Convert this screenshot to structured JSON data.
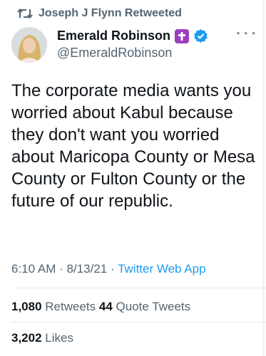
{
  "retweet_header": {
    "label": "Joseph J Flynn Retweeted",
    "icon": "retweet-icon"
  },
  "author": {
    "name": "Emerald Robinson",
    "handle": "@EmeraldRobinson",
    "badges": [
      "cross-icon",
      "verified-icon"
    ],
    "badge_colors": {
      "cross": "#9b3fbd",
      "verified": "#1d9bf0"
    }
  },
  "tweet": {
    "text": "The corporate media wants you worried about Kabul because they don't want you worried about Maricopa County or Mesa County or Fulton County or the future of our republic.",
    "time": "6:10 AM",
    "date": "8/13/21",
    "separator": "·",
    "source": "Twitter Web App"
  },
  "stats": {
    "retweets_count": "1,080",
    "retweets_label": "Retweets",
    "quote_count": "44",
    "quote_label": "Quote Tweets",
    "likes_count": "3,202",
    "likes_label": "Likes"
  },
  "colors": {
    "link": "#1d9bf0",
    "muted": "#536471",
    "text": "#0f1419"
  }
}
